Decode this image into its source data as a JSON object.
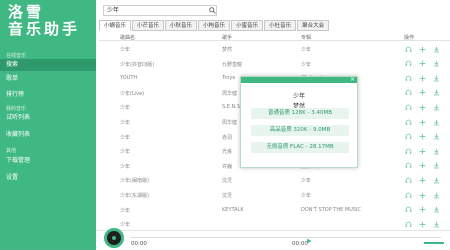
{
  "app": {
    "logo_line1": "洛雪",
    "logo_line2": "音乐助手"
  },
  "sidebar": {
    "section_online": "在线音乐",
    "section_mine": "我的音乐",
    "section_other": "其他",
    "items": [
      {
        "label": "搜索",
        "active": true
      },
      {
        "label": "歌单"
      },
      {
        "label": "排行榜"
      },
      {
        "label": "试听列表"
      },
      {
        "label": "收藏列表"
      },
      {
        "label": "下载管理"
      },
      {
        "label": "设置"
      }
    ]
  },
  "search": {
    "value": "少年",
    "icon": "search-icon"
  },
  "tabs": [
    "小蜗音乐",
    "小芒音乐",
    "小秋音乐",
    "小枸音乐",
    "小蜜音乐",
    "小杜音乐",
    "聚合大会"
  ],
  "table": {
    "headers": {
      "title": "歌曲名",
      "artist": "歌手",
      "album": "专辑",
      "actions": "操作"
    },
    "rows": [
      {
        "title": "少年",
        "artist": "梦然",
        "album": "少年"
      },
      {
        "title": "少年(抖音DJ版)",
        "artist": "九野皇龍",
        "album": "少年"
      },
      {
        "title": "YOUTH",
        "artist": "Troye",
        "album": "(Deluxe)"
      },
      {
        "title": "少年(Live)",
        "artist": "周华健",
        "album": "第11期"
      },
      {
        "title": "少年",
        "artist": "S.E.N.S",
        "album": ""
      },
      {
        "title": "少年",
        "artist": "周华健",
        "album": ""
      },
      {
        "title": "少年",
        "artist": "赤羽",
        "album": ""
      },
      {
        "title": "少年",
        "artist": "光良",
        "album": ""
      },
      {
        "title": "少年",
        "artist": "许巍",
        "album": "爱如少年"
      },
      {
        "title": "少年(闽南版)",
        "artist": "沈灵",
        "album": "少年"
      },
      {
        "title": "少年(东湖版)",
        "artist": "沈灵",
        "album": "少年"
      },
      {
        "title": "少年",
        "artist": "KEYTALK",
        "album": "DON'T STOP THE MUSIC"
      },
      {
        "title": "少年",
        "artist": "",
        "album": ""
      }
    ]
  },
  "dialog": {
    "song": "少年",
    "artist": "梦然",
    "close": "×",
    "qualities": [
      "普通音质 128K - 3.40MB",
      "高品音质 320K - 9.0MB",
      "无损音质 FLAC - 28.17MB"
    ]
  },
  "player": {
    "time_current": "00:00",
    "time_total": "00:00",
    "progress": 0.0
  },
  "colors": {
    "accent": "#3fb883",
    "accent_dark": "#2e9a6b"
  }
}
